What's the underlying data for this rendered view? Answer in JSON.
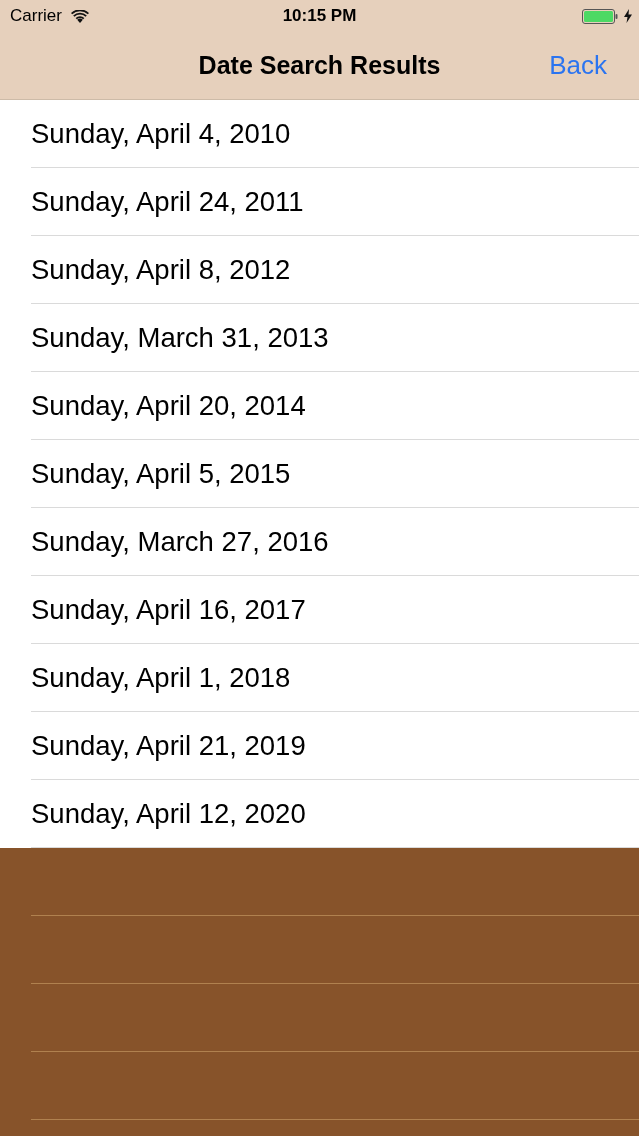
{
  "status_bar": {
    "carrier": "Carrier",
    "time": "10:15 PM",
    "charging": true
  },
  "nav_bar": {
    "title": "Date Search Results",
    "back": "Back"
  },
  "results": [
    {
      "label": "Sunday, April 4, 2010"
    },
    {
      "label": "Sunday, April 24, 2011"
    },
    {
      "label": "Sunday, April 8, 2012"
    },
    {
      "label": "Sunday, March 31, 2013"
    },
    {
      "label": "Sunday, April 20, 2014"
    },
    {
      "label": "Sunday, April 5, 2015"
    },
    {
      "label": "Sunday, March 27, 2016"
    },
    {
      "label": "Sunday, April 16, 2017"
    },
    {
      "label": "Sunday, April 1, 2018"
    },
    {
      "label": "Sunday, April 21, 2019"
    },
    {
      "label": "Sunday, April 12, 2020"
    }
  ]
}
